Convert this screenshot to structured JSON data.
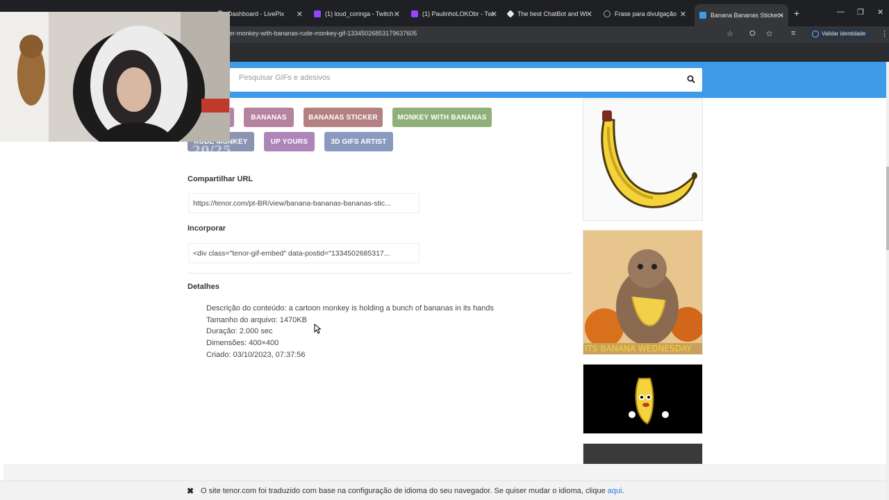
{
  "browser": {
    "tabs": [
      {
        "label": "Dashboard - LivePix",
        "color": "#9aa0a6"
      },
      {
        "label": "(1) loud_coringa - Twitch",
        "color": "#9146ff"
      },
      {
        "label": "(1) PaulinhoLOKObr - Twi",
        "color": "#9146ff"
      },
      {
        "label": "The best ChatBot and Wi",
        "color": "#e8e8e8"
      },
      {
        "label": "Frase para divulgação",
        "color": "#9aa0a6"
      },
      {
        "label": "Banana Bananas Sticker -",
        "color": "#3d9be9"
      }
    ],
    "url": "er-monkey-with-bananas-rude-monkey-gif-13345026853179637605",
    "validate_identity": "Validar identidade"
  },
  "search": {
    "placeholder": "Pesquisar GIFs e adesivos"
  },
  "tags": [
    {
      "label": "BANANAS",
      "color": "#b5839f"
    },
    {
      "label": "BANANAS STICKER",
      "color": "#b48182"
    },
    {
      "label": "MONKEY WITH BANANAS",
      "color": "#8fb07a"
    },
    {
      "label": "RUDE MONKEY",
      "color": "#8b94b1"
    },
    {
      "label": "UP YOURS",
      "color": "#ae85b8"
    },
    {
      "label": "3D GIFS ARTIST",
      "color": "#8a9abf"
    }
  ],
  "share": {
    "title": "Compartilhar URL",
    "url": "https://tenor.com/pt-BR/view/banana-bananas-bananas-stic..."
  },
  "embed": {
    "title": "Incorporar",
    "code": "<div class=\"tenor-gif-embed\" data-postid=\"1334502685317..."
  },
  "details": {
    "title": "Detalhes",
    "description": "Descrição do conteúdo: a cartoon monkey is holding a bunch of bananas in its hands",
    "size": "Tamanho do arquivo: 1470KB",
    "duration": "Duração: 2.000 sec",
    "dimensions": "Dimensões: 400×400",
    "created": "Criado: 03/10/2023, 07:37:56"
  },
  "related": {
    "wednesday_caption": "ITS BANANA WEDNESDAY"
  },
  "overlay": {
    "subs": "SUBS 20/25"
  },
  "notice": {
    "text": "O site tenor.com foi traduzido com base na configuração de idioma do seu navegador. Se quiser mudar o idioma, clique ",
    "link": "aqui",
    "end": "."
  }
}
